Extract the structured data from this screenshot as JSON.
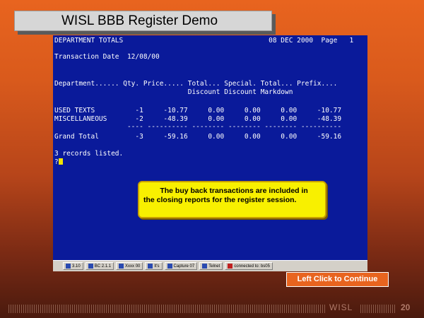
{
  "slide": {
    "title": "WISL BBB Register Demo",
    "continue_label": "Left Click to Continue",
    "brand": "WISL",
    "page_number": "20"
  },
  "terminal": {
    "lines": [
      "DEPARTMENT TOTALS                                    08 DEC 2000  Page   1",
      "Transaction Date  12/08/00",
      "",
      "Department...... Qty. Price..... Total... Special. Total... Prefix....",
      "                                 Discount Discount Markdown",
      "",
      "USED TEXTS          -1     -10.77     0.00     0.00     0.00     -10.77",
      "MISCELLANEOUS       -2     -48.39     0.00     0.00     0.00     -48.39",
      "                  ---- ---------- -------- -------- -------- ----------",
      "Grand Total         -3     -59.16     0.00     0.00     0.00     -59.16",
      "",
      "3 records listed.",
      "?"
    ]
  },
  "callout": {
    "text": "        The buy back transactions are included in the closing reports for the register session."
  },
  "taskbar": {
    "items": [
      {
        "label": "3.10",
        "icon": "window-icon"
      },
      {
        "label": "BC 2.1.1",
        "icon": "window-icon"
      },
      {
        "label": "Xxxx 00",
        "icon": "window-icon"
      },
      {
        "label": "lt's",
        "icon": "window-icon"
      },
      {
        "label": "Capture 07",
        "icon": "window-icon"
      },
      {
        "label": "Telnet",
        "icon": "window-icon"
      },
      {
        "label": "connected to: bs05",
        "icon": "connection-icon"
      }
    ]
  },
  "colors": {
    "terminal_bg": "#0a1a9a",
    "cursor": "#f2e400",
    "callout_bg": "#f8f000",
    "button_bg": "#e8641f"
  }
}
